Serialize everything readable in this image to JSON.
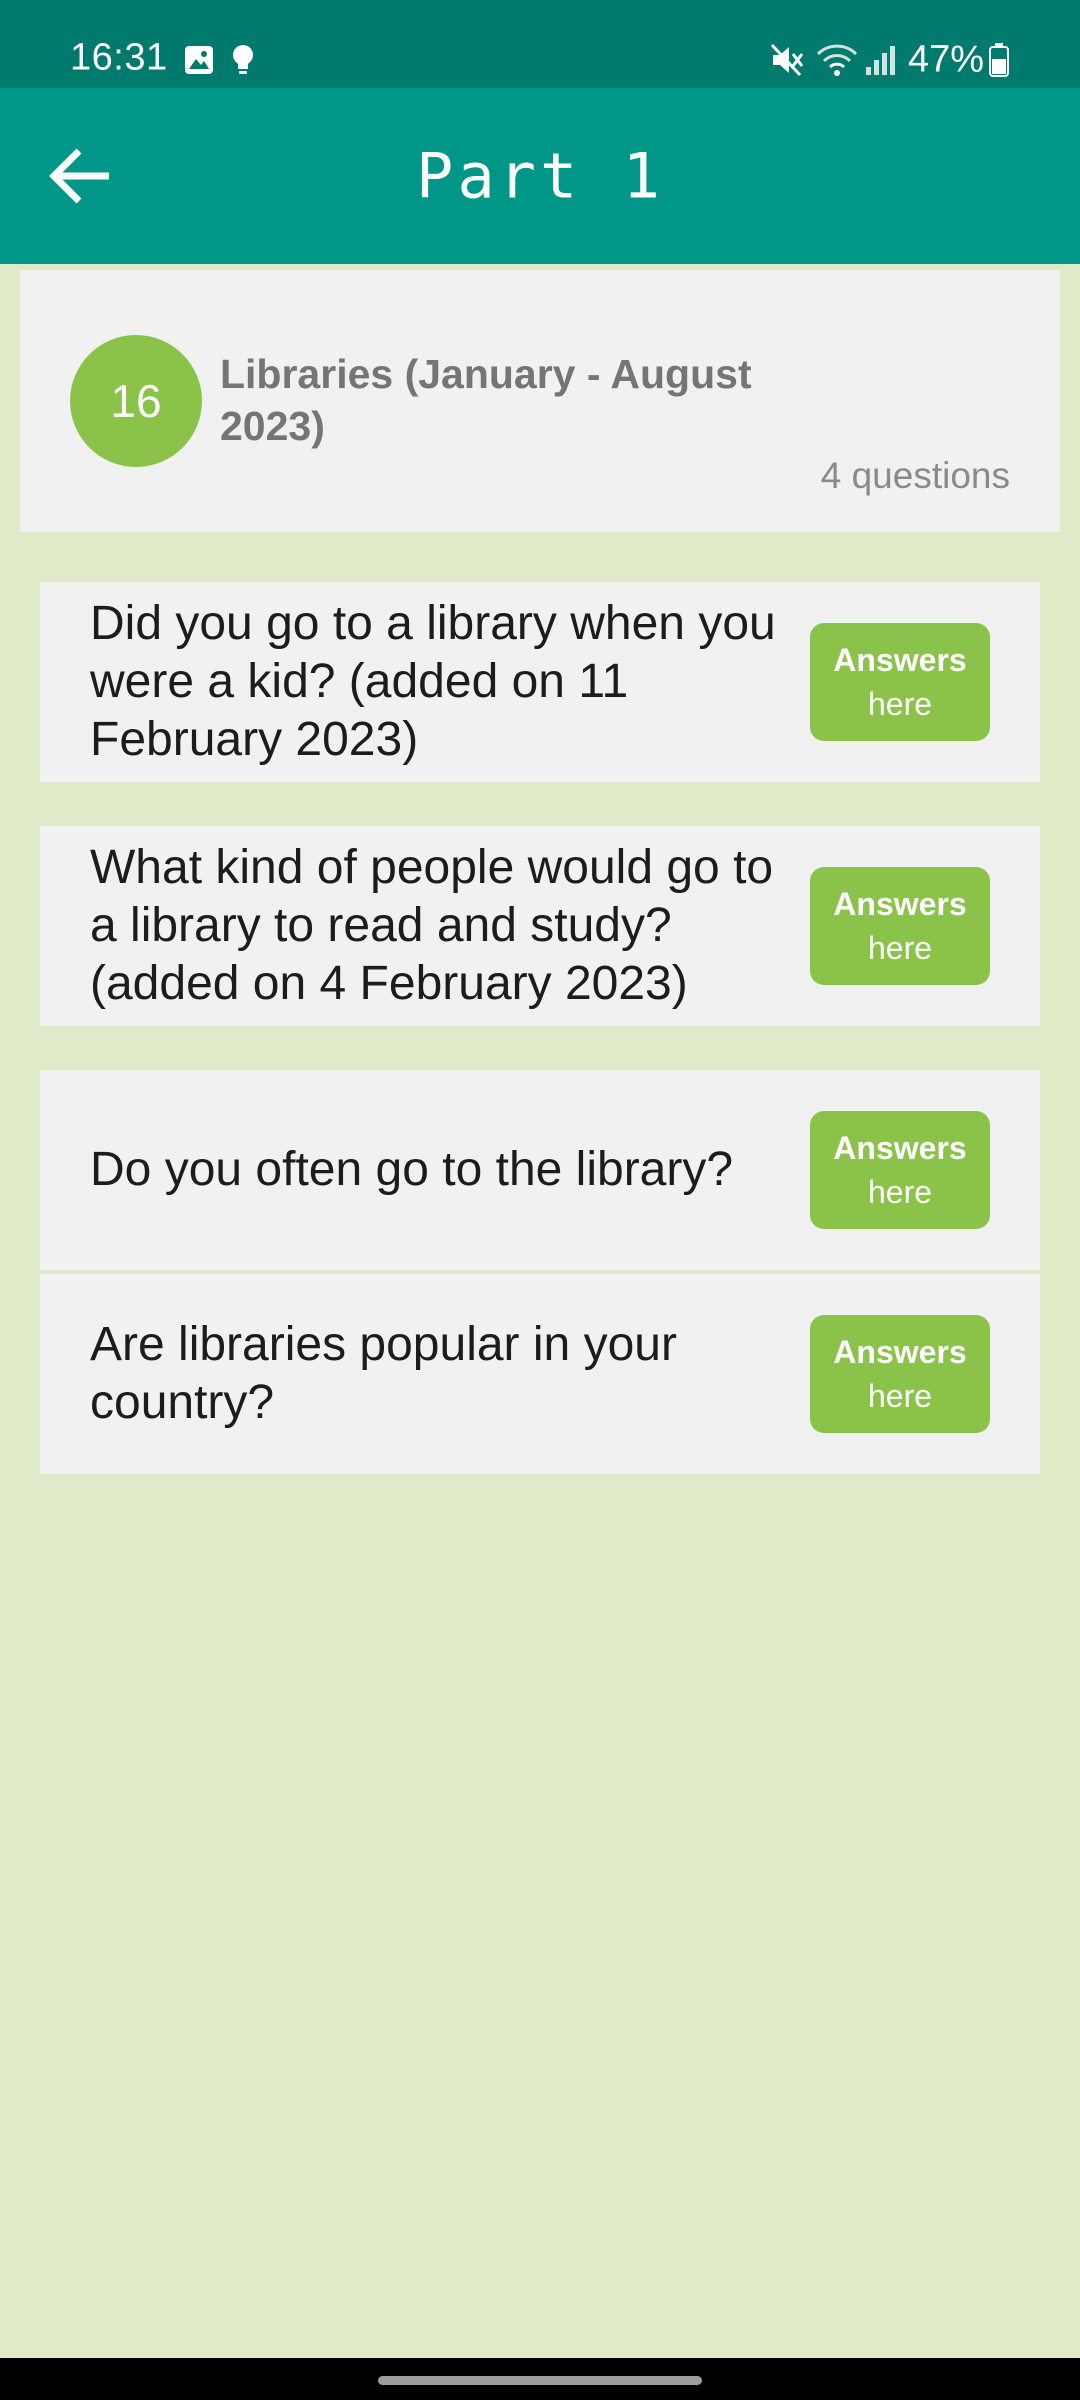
{
  "status_bar": {
    "time": "16:31",
    "battery_percent": "47%",
    "icons": [
      "gallery-icon",
      "lightbulb-icon",
      "mute-icon",
      "wifi-icon",
      "signal-icon",
      "battery-icon"
    ]
  },
  "app_bar": {
    "title": "Part 1",
    "back_icon": "arrow-left-icon"
  },
  "topic": {
    "number": "16",
    "title": "Libraries (January - August 2023)",
    "count": "4 questions"
  },
  "questions": [
    {
      "text": "Did you go to a library when you were a kid? (added on 11 February 2023)",
      "button_line1": "Answers",
      "button_line2": "here"
    },
    {
      "text": "What kind of people would go to a library to read and study? (added on 4 February 2023)",
      "button_line1": "Answers",
      "button_line2": "here"
    },
    {
      "text": "Do you often go to the library?",
      "button_line1": "Answers",
      "button_line2": "here"
    },
    {
      "text": "Are libraries popular in your country?",
      "button_line1": "Answers",
      "button_line2": "here"
    }
  ],
  "colors": {
    "status_bar": "#007a6d",
    "app_bar": "#009688",
    "accent_green": "#8bc34a",
    "page_background": "#dfebc8",
    "card_background": "#f1f1f1"
  }
}
